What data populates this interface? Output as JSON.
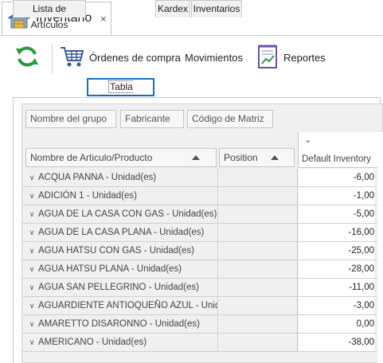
{
  "doc_tab": {
    "title": "Inventario",
    "close": "×"
  },
  "toolbar": {
    "ordenes": "Órdenes de compra",
    "movimientos": "Movimientos",
    "reportes": "Reportes"
  },
  "page_tabs": [
    "Lista de Artículos",
    "Tabla Dinámica",
    "Kardex",
    "Inventarios"
  ],
  "group_fields": [
    "Nombre del grupo",
    "Fabricante",
    "Código de Matriz"
  ],
  "columns": {
    "name": "Nombre de Articulo/Producto",
    "position": "Position",
    "value": "Default Inventory"
  },
  "rows": [
    {
      "name": "ACQUA PANNA - Unidad(es)",
      "value": "-6,00"
    },
    {
      "name": "ADICIÓN 1 - Unidad(es)",
      "value": "-1,00"
    },
    {
      "name": "AGUA DE LA CASA CON GAS - Unidad(es)",
      "value": "-5,00"
    },
    {
      "name": "AGUA DE LA CASA PLANA - Unidad(es)",
      "value": "-16,00"
    },
    {
      "name": "AGUA HATSU CON GAS - Unidad(es)",
      "value": "-25,00"
    },
    {
      "name": "AGUA HATSU PLANA - Unidad(es)",
      "value": "-28,00"
    },
    {
      "name": "AGUA SAN PELLEGRINO - Unidad(es)",
      "value": "-11,00"
    },
    {
      "name": "AGUARDIENTE ANTIOQUEÑO AZUL - Unidad…",
      "value": "-3,00"
    },
    {
      "name": "AMARETTO DISARONNO - Unidad(es)",
      "value": "0,00"
    },
    {
      "name": "AMERICANO - Unidad(es)",
      "value": "-38,00"
    }
  ],
  "colors": {
    "accent": "#1b6ec2",
    "refresh_green": "#2e9a44",
    "reportes_purple": "#6b4fa0"
  }
}
